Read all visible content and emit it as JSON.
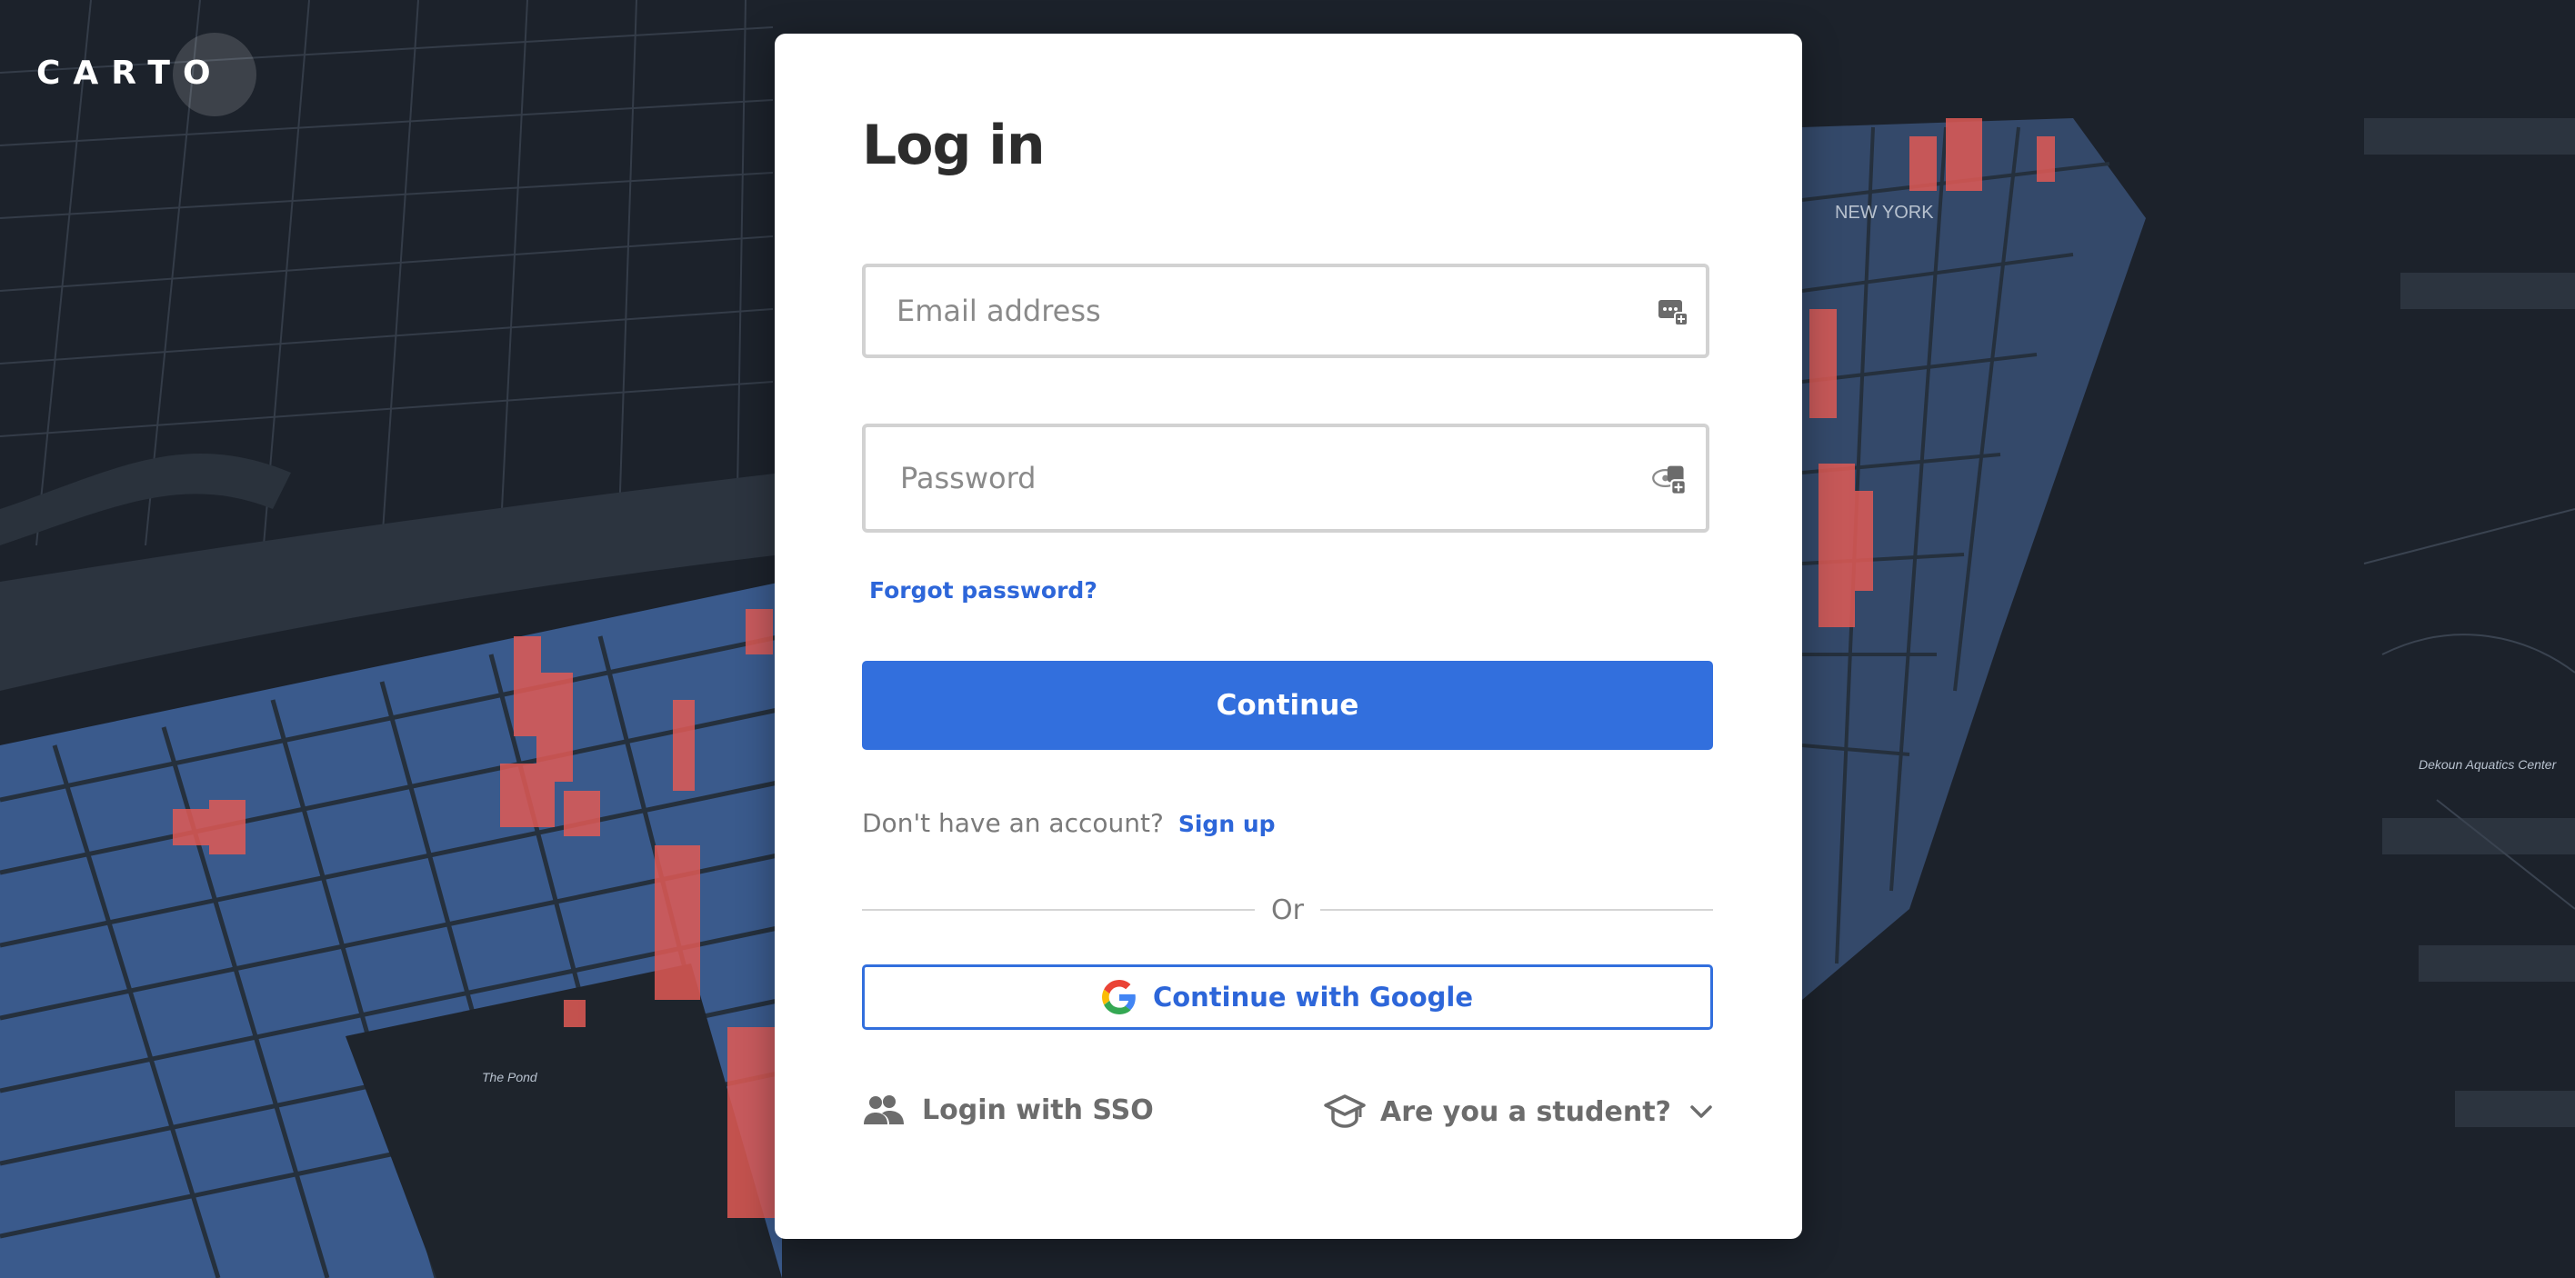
{
  "brand": {
    "logo_text": "CARTO"
  },
  "login": {
    "title": "Log in",
    "email_placeholder": "Email address",
    "password_placeholder": "Password",
    "forgot_label": "Forgot password?",
    "continue_label": "Continue",
    "no_account_text": "Don't have an account?",
    "signup_label": "Sign up",
    "or_label": "Or",
    "google_label": "Continue with Google",
    "sso_label": "Login with SSO",
    "student_label": "Are you a student?"
  },
  "map": {
    "labels": [
      "NEW YORK",
      "Dekoun Aquatics Center",
      "The Pond"
    ]
  },
  "colors": {
    "accent": "#326fdd",
    "link": "#2d66d9",
    "map_background": "#1c222b",
    "buildings": "#3a5a8c",
    "highlight": "#e05a55"
  },
  "icons": {
    "email_field_icon": "autofill-key-icon",
    "password_field_icon": "autofill-key-icon",
    "google": "google-g-icon",
    "sso": "people-icon",
    "student": "graduation-cap-icon",
    "dropdown": "chevron-down-icon"
  }
}
